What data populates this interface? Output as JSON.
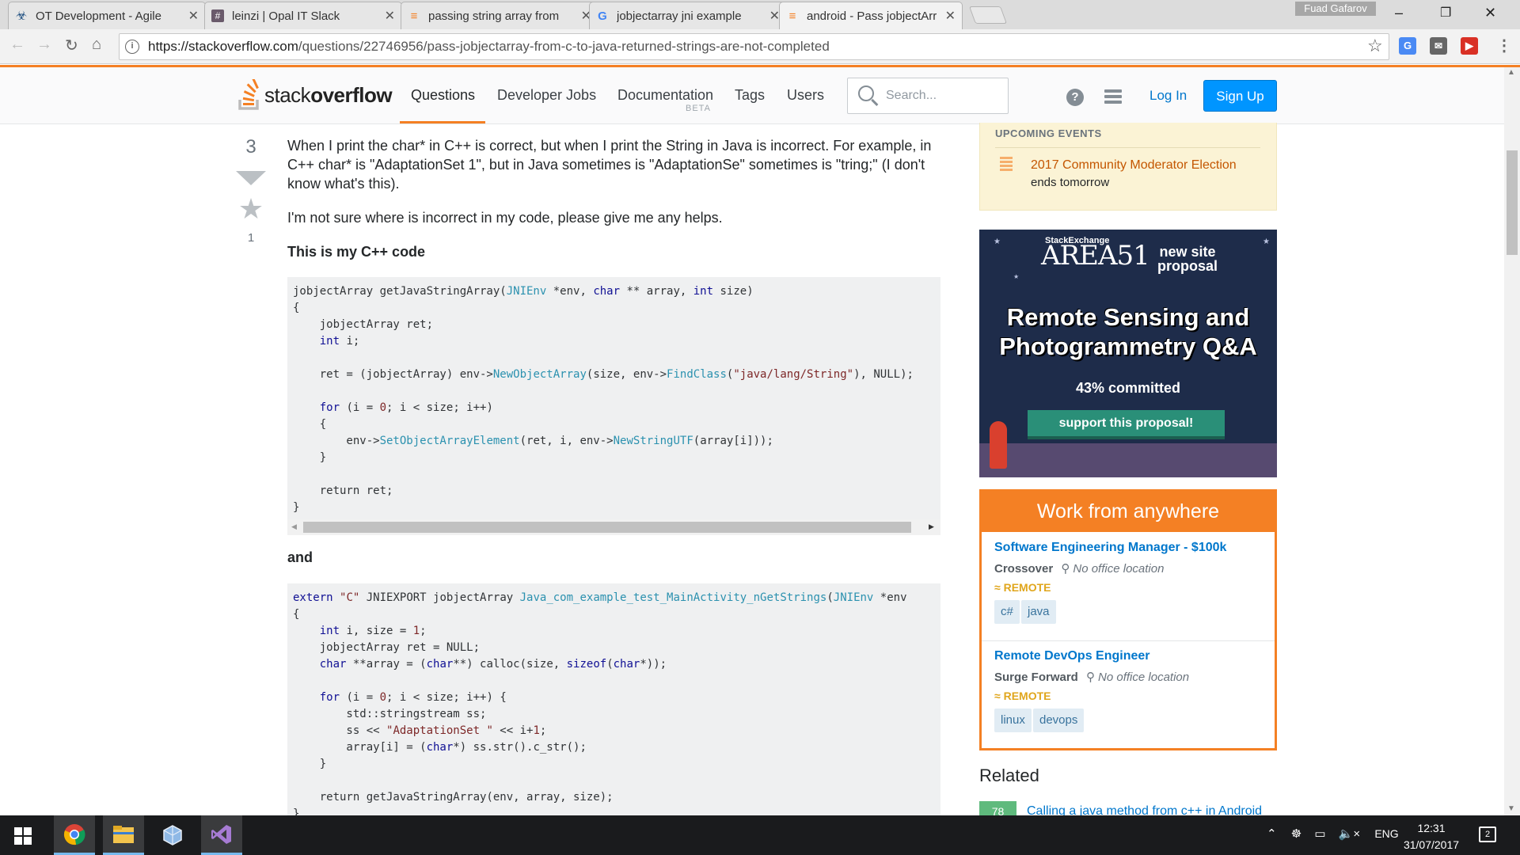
{
  "browser": {
    "tabs": [
      {
        "title": "OT Development - Agile",
        "icon": "agile-icon"
      },
      {
        "title": "leinzi | Opal IT Slack",
        "icon": "slack-icon"
      },
      {
        "title": "passing string array from",
        "icon": "stackoverflow-icon"
      },
      {
        "title": "jobjectarray jni example",
        "icon": "google-icon"
      },
      {
        "title": "android - Pass jobjectArr",
        "icon": "stackoverflow-icon",
        "active": true
      }
    ],
    "profile_name": "Fuad Gafarov",
    "url_host": "https://stackoverflow.com",
    "url_path": "/questions/22746956/pass-jobjectarray-from-c-to-java-returned-strings-are-not-completed"
  },
  "header": {
    "logo_stack": "stack",
    "logo_overflow": "overflow",
    "nav": [
      "Questions",
      "Developer Jobs",
      "Documentation",
      "Tags",
      "Users"
    ],
    "beta": "BETA",
    "search_placeholder": "Search...",
    "login": "Log In",
    "signup": "Sign Up"
  },
  "question": {
    "vote_count": "3",
    "favorite_count": "1",
    "para1": "When I print the char* in C++ is correct, but when I print the String in Java is incorrect. For example, in C++ char* is \"AdaptationSet 1\", but in Java sometimes is \"AdaptationSe\" sometimes is \"tring;\" (I don't know what's this).",
    "para2": "I'm not sure where is incorrect in my code, please give me any helps.",
    "heading1": "This is my C++ code",
    "heading2": "and",
    "code1": [
      [
        [
          "t",
          "jobjectArray getJavaStringArray("
        ],
        [
          "f",
          "JNIEnv"
        ],
        [
          "t",
          " *env, "
        ],
        [
          "k",
          "char"
        ],
        [
          "t",
          " ** array, "
        ],
        [
          "k",
          "int"
        ],
        [
          "t",
          " size)"
        ]
      ],
      [
        [
          "t",
          "{"
        ]
      ],
      [
        [
          "t",
          "    jobjectArray ret;"
        ]
      ],
      [
        [
          "t",
          "    "
        ],
        [
          "k",
          "int"
        ],
        [
          "t",
          " i;"
        ]
      ],
      [
        [
          "t",
          ""
        ]
      ],
      [
        [
          "t",
          "    ret = (jobjectArray) env->"
        ],
        [
          "f",
          "NewObjectArray"
        ],
        [
          "t",
          "(size, env->"
        ],
        [
          "f",
          "FindClass"
        ],
        [
          "t",
          "("
        ],
        [
          "s",
          "\"java/lang/String\""
        ],
        [
          "t",
          "), NULL);"
        ]
      ],
      [
        [
          "t",
          ""
        ]
      ],
      [
        [
          "t",
          "    "
        ],
        [
          "k",
          "for"
        ],
        [
          "t",
          " (i = "
        ],
        [
          "n",
          "0"
        ],
        [
          "t",
          "; i < size; i++)"
        ]
      ],
      [
        [
          "t",
          "    {"
        ]
      ],
      [
        [
          "t",
          "        env->"
        ],
        [
          "f",
          "SetObjectArrayElement"
        ],
        [
          "t",
          "(ret, i, env->"
        ],
        [
          "f",
          "NewStringUTF"
        ],
        [
          "t",
          "(array[i]));"
        ]
      ],
      [
        [
          "t",
          "    }"
        ]
      ],
      [
        [
          "t",
          ""
        ]
      ],
      [
        [
          "t",
          "    return ret;"
        ]
      ],
      [
        [
          "t",
          "}"
        ]
      ]
    ],
    "code2": [
      [
        [
          "k",
          "extern"
        ],
        [
          "t",
          " "
        ],
        [
          "s",
          "\"C\""
        ],
        [
          "t",
          " JNIEXPORT jobjectArray "
        ],
        [
          "f",
          "Java_com_example_test_MainActivity_nGetStrings"
        ],
        [
          "t",
          "("
        ],
        [
          "f",
          "JNIEnv"
        ],
        [
          "t",
          " *env"
        ]
      ],
      [
        [
          "t",
          "{"
        ]
      ],
      [
        [
          "t",
          "    "
        ],
        [
          "k",
          "int"
        ],
        [
          "t",
          " i, size = "
        ],
        [
          "n",
          "1"
        ],
        [
          "t",
          ";"
        ]
      ],
      [
        [
          "t",
          "    jobjectArray ret = NULL;"
        ]
      ],
      [
        [
          "t",
          "    "
        ],
        [
          "k",
          "char"
        ],
        [
          "t",
          " **array = ("
        ],
        [
          "k",
          "char"
        ],
        [
          "t",
          "**) calloc(size, "
        ],
        [
          "k",
          "sizeof"
        ],
        [
          "t",
          "("
        ],
        [
          "k",
          "char"
        ],
        [
          "t",
          "*));"
        ]
      ],
      [
        [
          "t",
          ""
        ]
      ],
      [
        [
          "t",
          "    "
        ],
        [
          "k",
          "for"
        ],
        [
          "t",
          " (i = "
        ],
        [
          "n",
          "0"
        ],
        [
          "t",
          "; i < size; i++) {"
        ]
      ],
      [
        [
          "t",
          "        std::stringstream ss;"
        ]
      ],
      [
        [
          "t",
          "        ss << "
        ],
        [
          "s",
          "\"AdaptationSet \""
        ],
        [
          "t",
          " << i+"
        ],
        [
          "n",
          "1"
        ],
        [
          "t",
          ";"
        ]
      ],
      [
        [
          "t",
          "        array[i] = ("
        ],
        [
          "k",
          "char"
        ],
        [
          "t",
          "*) ss.str().c_str();"
        ]
      ],
      [
        [
          "t",
          "    }"
        ]
      ],
      [
        [
          "t",
          ""
        ]
      ],
      [
        [
          "t",
          "    return getJavaStringArray(env, array, size);"
        ]
      ],
      [
        [
          "t",
          "}"
        ]
      ]
    ]
  },
  "sidebar": {
    "events_title": "UPCOMING EVENTS",
    "event_link": "2017 Community Moderator Election",
    "event_sub": "ends tomorrow",
    "ad": {
      "brand_small": "StackExchange",
      "brand": "AREA51",
      "new_site": "new site proposal",
      "headline": "Remote Sensing and Photogrammetry Q&A",
      "committed": "43% committed",
      "button": "support this proposal!"
    },
    "jobs_title": "Work from anywhere",
    "jobs": [
      {
        "title": "Software Engineering Manager - $100k",
        "company": "Crossover",
        "location": "No office location",
        "remote": "REMOTE",
        "tags": [
          "c#",
          "java"
        ]
      },
      {
        "title": "Remote DevOps Engineer",
        "company": "Surge Forward",
        "location": "No office location",
        "remote": "REMOTE",
        "tags": [
          "linux",
          "devops"
        ]
      }
    ],
    "related_title": "Related",
    "related": [
      {
        "score": "78",
        "title": "Calling a java method from c++ in Android"
      }
    ]
  },
  "taskbar": {
    "apps": [
      "chrome-icon",
      "file-explorer-icon",
      "virtualbox-icon",
      "visual-studio-icon"
    ],
    "lang": "ENG",
    "time": "12:31",
    "date": "31/07/2017"
  }
}
